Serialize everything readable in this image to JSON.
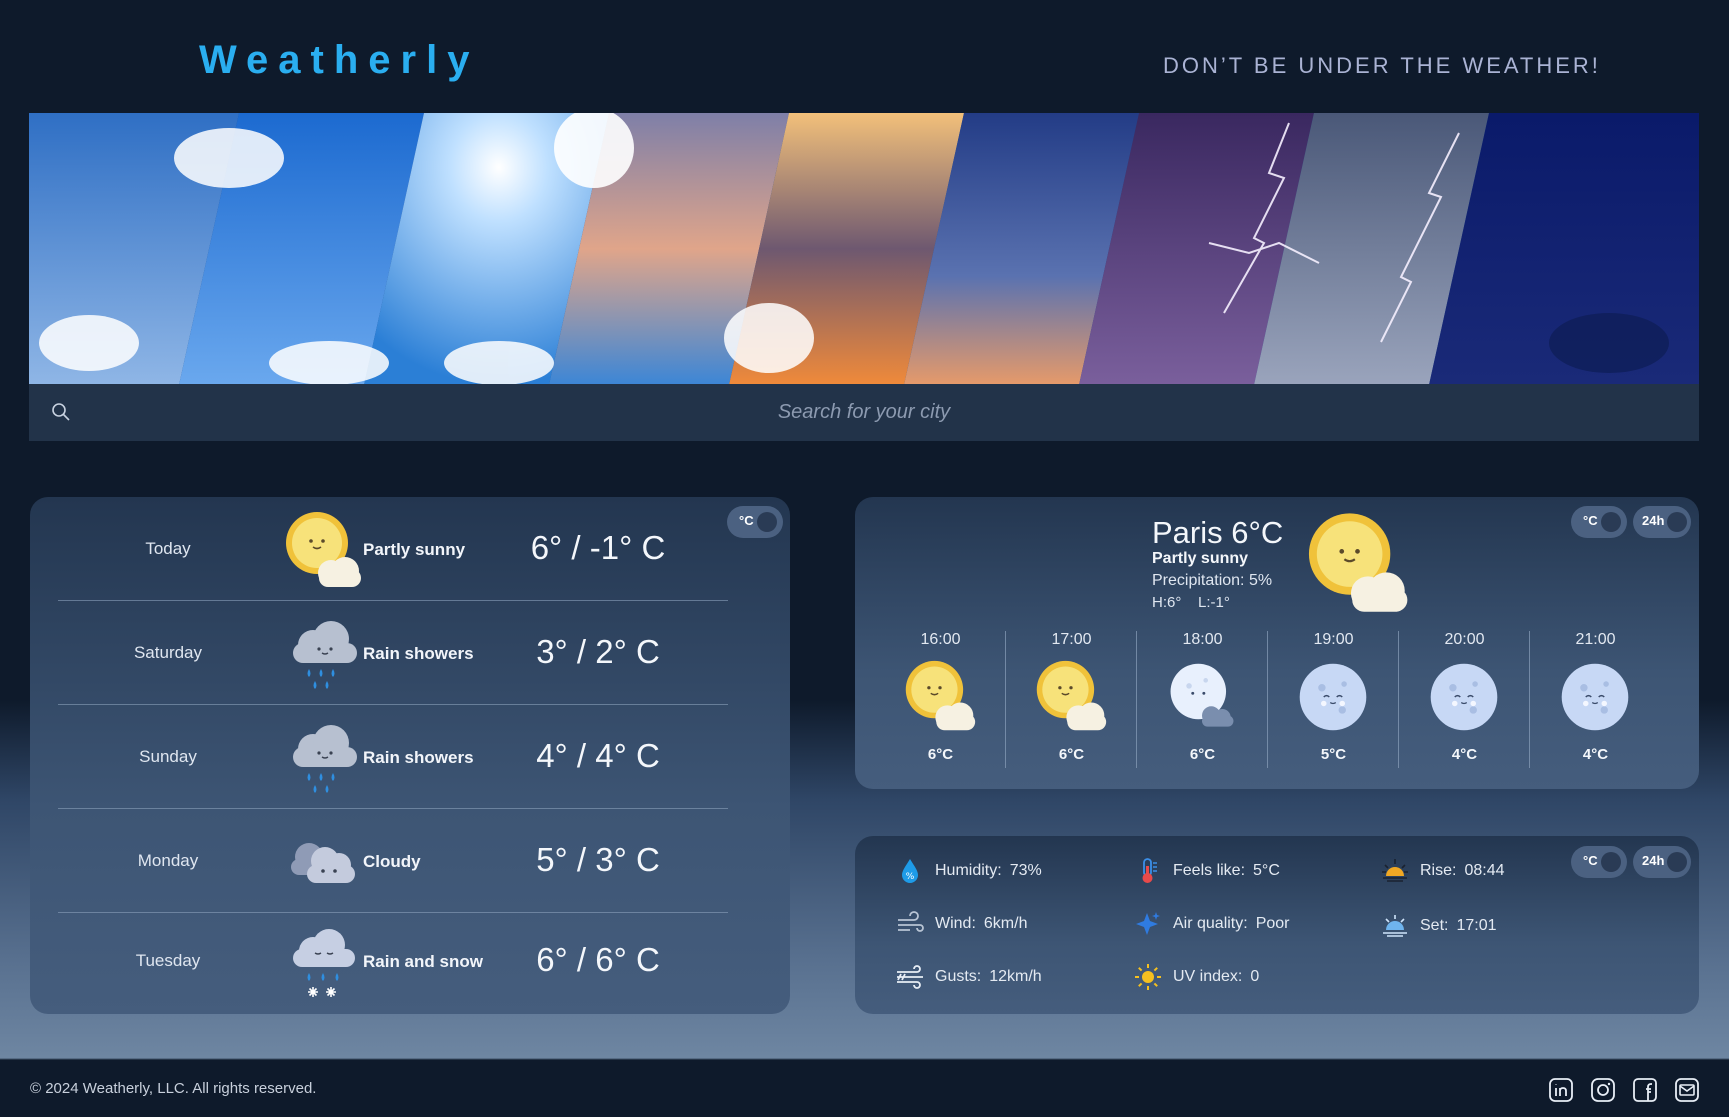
{
  "header": {
    "logo": "Weatherly",
    "tagline": "DON’T BE UNDER THE WEATHER!"
  },
  "search": {
    "placeholder": "Search for your city",
    "icon": "search-icon"
  },
  "forecast": {
    "unit_toggle": "°C",
    "days": [
      {
        "day": "Today",
        "icon": "partly-sunny-icon",
        "desc": "Partly sunny",
        "temp": "6° / -1° C"
      },
      {
        "day": "Saturday",
        "icon": "rain-showers-icon",
        "desc": "Rain showers",
        "temp": "3° / 2° C"
      },
      {
        "day": "Sunday",
        "icon": "rain-showers-icon",
        "desc": "Rain showers",
        "temp": "4° / 4° C"
      },
      {
        "day": "Monday",
        "icon": "cloudy-icon",
        "desc": "Cloudy",
        "temp": "5° / 3° C"
      },
      {
        "day": "Tuesday",
        "icon": "rain-and-snow-icon",
        "desc": "Rain and snow",
        "temp": "6° / 6° C"
      }
    ]
  },
  "current": {
    "city": "Paris 6°C",
    "condition": "Partly sunny",
    "precipitation": "Precipitation: 5%",
    "hilo": "H:6°    L:-1°",
    "unit_toggle": "°C",
    "time_toggle": "24h",
    "hourly": [
      {
        "time": "16:00",
        "icon": "partly-sunny-icon",
        "temp": "6°C"
      },
      {
        "time": "17:00",
        "icon": "partly-sunny-icon",
        "temp": "6°C"
      },
      {
        "time": "18:00",
        "icon": "moon-cloud-icon",
        "temp": "6°C"
      },
      {
        "time": "19:00",
        "icon": "moon-icon",
        "temp": "5°C"
      },
      {
        "time": "20:00",
        "icon": "moon-icon",
        "temp": "4°C"
      },
      {
        "time": "21:00",
        "icon": "moon-icon",
        "temp": "4°C"
      }
    ]
  },
  "details": {
    "unit_toggle": "°C",
    "time_toggle": "24h",
    "humidity": {
      "label": "Humidity:",
      "value": "73%"
    },
    "wind": {
      "label": "Wind:",
      "value": "6km/h"
    },
    "gusts": {
      "label": "Gusts:",
      "value": "12km/h"
    },
    "feels_like": {
      "label": "Feels like:",
      "value": "5°C"
    },
    "air_quality": {
      "label": "Air quality:",
      "value": "Poor"
    },
    "uv_index": {
      "label": "UV index:",
      "value": "0"
    },
    "rise": {
      "label": "Rise:",
      "value": "08:44"
    },
    "set": {
      "label": "Set:",
      "value": "17:01"
    }
  },
  "footer": {
    "copyright": "© 2024 Weatherly, LLC. All rights reserved.",
    "social": [
      "linkedin-icon",
      "instagram-icon",
      "facebook-icon",
      "mail-icon"
    ]
  },
  "colors": {
    "accent": "#2aaef0",
    "background": "#0e1a2b",
    "card": "#3d5574"
  }
}
